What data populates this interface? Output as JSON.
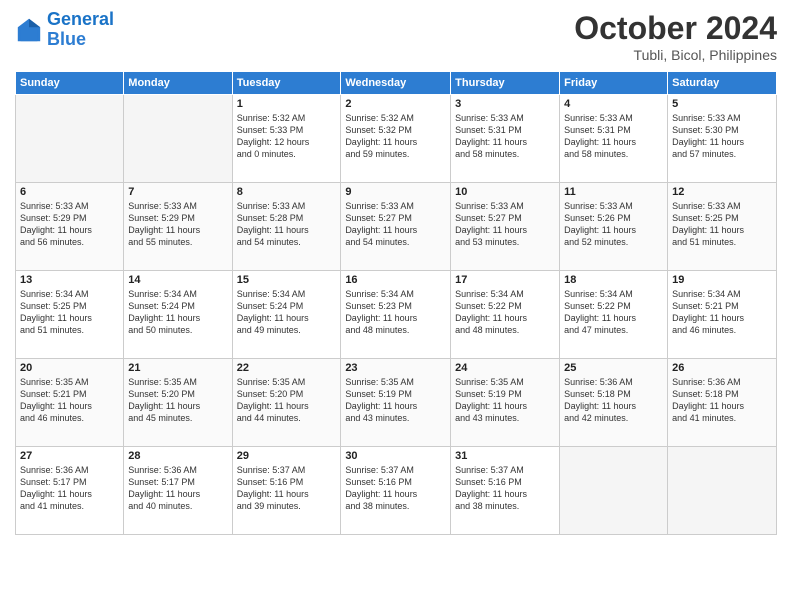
{
  "logo": {
    "line1": "General",
    "line2": "Blue"
  },
  "title": "October 2024",
  "subtitle": "Tubli, Bicol, Philippines",
  "headers": [
    "Sunday",
    "Monday",
    "Tuesday",
    "Wednesday",
    "Thursday",
    "Friday",
    "Saturday"
  ],
  "weeks": [
    [
      {
        "day": "",
        "info": ""
      },
      {
        "day": "",
        "info": ""
      },
      {
        "day": "1",
        "info": "Sunrise: 5:32 AM\nSunset: 5:33 PM\nDaylight: 12 hours\nand 0 minutes."
      },
      {
        "day": "2",
        "info": "Sunrise: 5:32 AM\nSunset: 5:32 PM\nDaylight: 11 hours\nand 59 minutes."
      },
      {
        "day": "3",
        "info": "Sunrise: 5:33 AM\nSunset: 5:31 PM\nDaylight: 11 hours\nand 58 minutes."
      },
      {
        "day": "4",
        "info": "Sunrise: 5:33 AM\nSunset: 5:31 PM\nDaylight: 11 hours\nand 58 minutes."
      },
      {
        "day": "5",
        "info": "Sunrise: 5:33 AM\nSunset: 5:30 PM\nDaylight: 11 hours\nand 57 minutes."
      }
    ],
    [
      {
        "day": "6",
        "info": "Sunrise: 5:33 AM\nSunset: 5:29 PM\nDaylight: 11 hours\nand 56 minutes."
      },
      {
        "day": "7",
        "info": "Sunrise: 5:33 AM\nSunset: 5:29 PM\nDaylight: 11 hours\nand 55 minutes."
      },
      {
        "day": "8",
        "info": "Sunrise: 5:33 AM\nSunset: 5:28 PM\nDaylight: 11 hours\nand 54 minutes."
      },
      {
        "day": "9",
        "info": "Sunrise: 5:33 AM\nSunset: 5:27 PM\nDaylight: 11 hours\nand 54 minutes."
      },
      {
        "day": "10",
        "info": "Sunrise: 5:33 AM\nSunset: 5:27 PM\nDaylight: 11 hours\nand 53 minutes."
      },
      {
        "day": "11",
        "info": "Sunrise: 5:33 AM\nSunset: 5:26 PM\nDaylight: 11 hours\nand 52 minutes."
      },
      {
        "day": "12",
        "info": "Sunrise: 5:33 AM\nSunset: 5:25 PM\nDaylight: 11 hours\nand 51 minutes."
      }
    ],
    [
      {
        "day": "13",
        "info": "Sunrise: 5:34 AM\nSunset: 5:25 PM\nDaylight: 11 hours\nand 51 minutes."
      },
      {
        "day": "14",
        "info": "Sunrise: 5:34 AM\nSunset: 5:24 PM\nDaylight: 11 hours\nand 50 minutes."
      },
      {
        "day": "15",
        "info": "Sunrise: 5:34 AM\nSunset: 5:24 PM\nDaylight: 11 hours\nand 49 minutes."
      },
      {
        "day": "16",
        "info": "Sunrise: 5:34 AM\nSunset: 5:23 PM\nDaylight: 11 hours\nand 48 minutes."
      },
      {
        "day": "17",
        "info": "Sunrise: 5:34 AM\nSunset: 5:22 PM\nDaylight: 11 hours\nand 48 minutes."
      },
      {
        "day": "18",
        "info": "Sunrise: 5:34 AM\nSunset: 5:22 PM\nDaylight: 11 hours\nand 47 minutes."
      },
      {
        "day": "19",
        "info": "Sunrise: 5:34 AM\nSunset: 5:21 PM\nDaylight: 11 hours\nand 46 minutes."
      }
    ],
    [
      {
        "day": "20",
        "info": "Sunrise: 5:35 AM\nSunset: 5:21 PM\nDaylight: 11 hours\nand 46 minutes."
      },
      {
        "day": "21",
        "info": "Sunrise: 5:35 AM\nSunset: 5:20 PM\nDaylight: 11 hours\nand 45 minutes."
      },
      {
        "day": "22",
        "info": "Sunrise: 5:35 AM\nSunset: 5:20 PM\nDaylight: 11 hours\nand 44 minutes."
      },
      {
        "day": "23",
        "info": "Sunrise: 5:35 AM\nSunset: 5:19 PM\nDaylight: 11 hours\nand 43 minutes."
      },
      {
        "day": "24",
        "info": "Sunrise: 5:35 AM\nSunset: 5:19 PM\nDaylight: 11 hours\nand 43 minutes."
      },
      {
        "day": "25",
        "info": "Sunrise: 5:36 AM\nSunset: 5:18 PM\nDaylight: 11 hours\nand 42 minutes."
      },
      {
        "day": "26",
        "info": "Sunrise: 5:36 AM\nSunset: 5:18 PM\nDaylight: 11 hours\nand 41 minutes."
      }
    ],
    [
      {
        "day": "27",
        "info": "Sunrise: 5:36 AM\nSunset: 5:17 PM\nDaylight: 11 hours\nand 41 minutes."
      },
      {
        "day": "28",
        "info": "Sunrise: 5:36 AM\nSunset: 5:17 PM\nDaylight: 11 hours\nand 40 minutes."
      },
      {
        "day": "29",
        "info": "Sunrise: 5:37 AM\nSunset: 5:16 PM\nDaylight: 11 hours\nand 39 minutes."
      },
      {
        "day": "30",
        "info": "Sunrise: 5:37 AM\nSunset: 5:16 PM\nDaylight: 11 hours\nand 38 minutes."
      },
      {
        "day": "31",
        "info": "Sunrise: 5:37 AM\nSunset: 5:16 PM\nDaylight: 11 hours\nand 38 minutes."
      },
      {
        "day": "",
        "info": ""
      },
      {
        "day": "",
        "info": ""
      }
    ]
  ]
}
